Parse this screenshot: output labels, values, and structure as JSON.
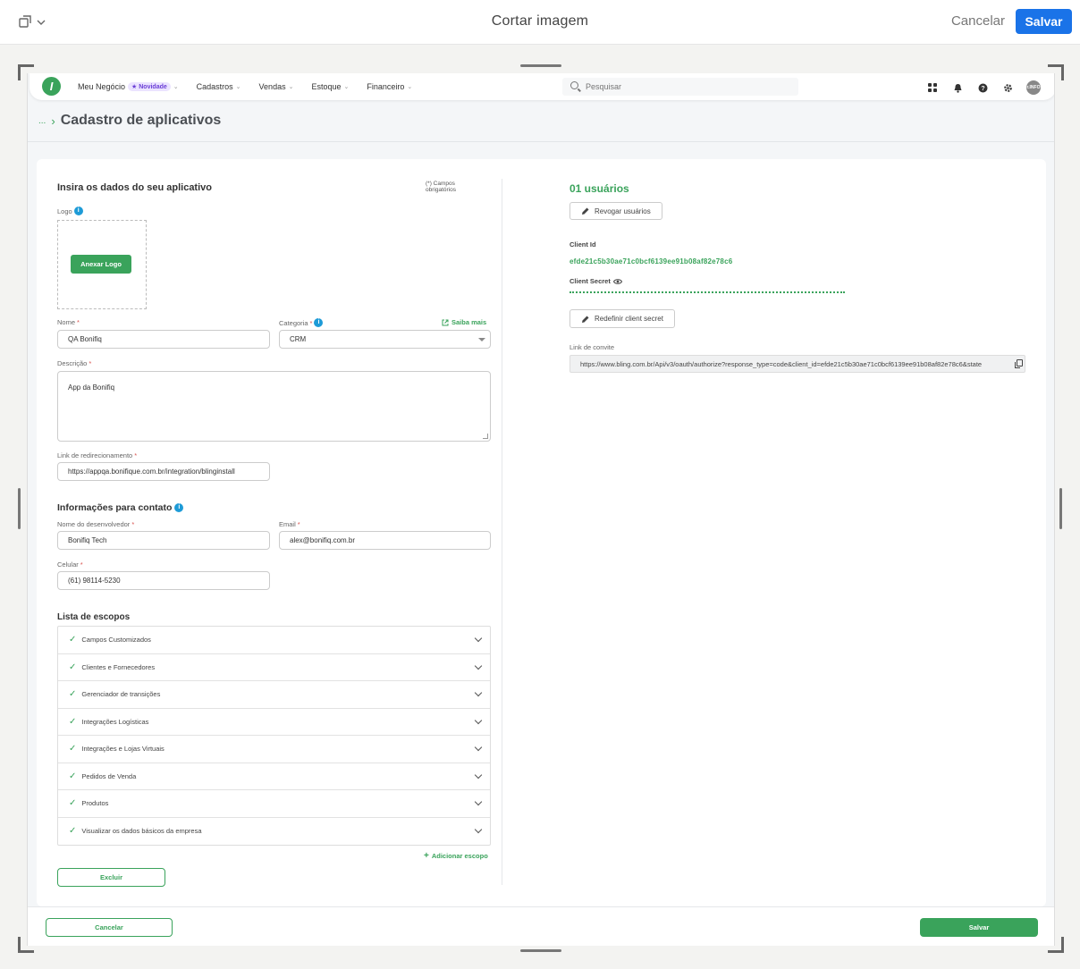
{
  "crop_toolbar": {
    "title": "Cortar imagem",
    "cancel_label": "Cancelar",
    "save_label": "Salvar"
  },
  "navbar": {
    "logo_letter": "I",
    "menu": [
      {
        "label": "Meu Negócio",
        "badge": "★ Novidade"
      },
      {
        "label": "Cadastros"
      },
      {
        "label": "Vendas"
      },
      {
        "label": "Estoque"
      },
      {
        "label": "Financeiro"
      }
    ],
    "search_placeholder": "Pesquisar",
    "avatar_text": "r.INFO"
  },
  "breadcrumb": {
    "ellipsis": "...",
    "title": "Cadastro de aplicativos"
  },
  "form": {
    "title": "Insira os dados do seu aplicativo",
    "required_note_line1": "(*) Campos",
    "required_note_line2": "obrigatórios",
    "logo_label": "Logo",
    "attach_logo_label": "Anexar Logo",
    "name_label": "Nome",
    "name_value": "QA Bonifiq",
    "category_label": "Categoria",
    "category_value": "CRM",
    "learn_more_label": "Saiba mais",
    "description_label": "Descrição",
    "description_value": "App da Bonifiq",
    "redirect_label": "Link de redirecionamento",
    "redirect_value": "https://appqa.bonifique.com.br/integration/blinginstall",
    "contact_title": "Informações para contato",
    "developer_label": "Nome do desenvolvedor",
    "developer_value": "Bonifiq Tech",
    "email_label": "Email",
    "email_value": "alex@bonifiq.com.br",
    "phone_label": "Celular",
    "phone_value": "(61) 98114-5230",
    "scopes_title": "Lista de escopos",
    "scopes": [
      "Campos Customizados",
      "Clientes e Fornecedores",
      "Gerenciador de transições",
      "Integrações Logísticas",
      "Integrações e Lojas Virtuais",
      "Pedidos de Venda",
      "Produtos",
      "Visualizar os dados básicos da empresa"
    ],
    "add_scope_label": "Adicionar escopo",
    "delete_label": "Excluir"
  },
  "credentials": {
    "users_title": "01 usuários",
    "revoke_label": "Revogar usuários",
    "client_id_label": "Client Id",
    "client_id_value": "efde21c5b30ae71c0bcf6139ee91b08af82e78c6",
    "client_secret_label": "Client Secret",
    "reset_secret_label": "Redefinir client secret",
    "invite_label": "Link de convite",
    "invite_value": "https://www.bling.com.br/Api/v3/oauth/authorize?response_type=code&client_id=efde21c5b30ae71c0bcf6139ee91b08af82e78c6&state"
  },
  "footer": {
    "cancel_label": "Cancelar",
    "save_label": "Salvar"
  },
  "colors": {
    "accent_green": "#3aa35b",
    "primary_blue": "#1a73e8",
    "info_blue": "#1e9bd7",
    "required_red": "#d9534f"
  }
}
